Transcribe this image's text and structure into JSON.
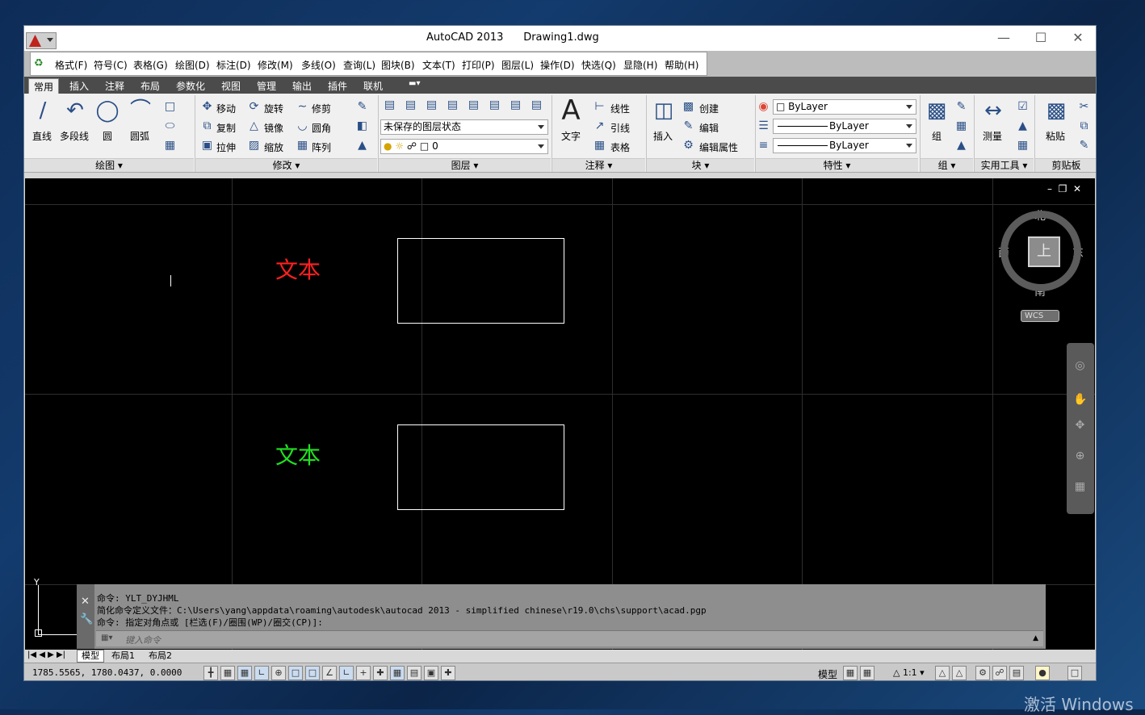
{
  "window": {
    "app_name": "AutoCAD 2013",
    "document": "Drawing1.dwg"
  },
  "menu": [
    "格式(F)",
    "符号(C)",
    "表格(G)",
    "绘图(D)",
    "标注(D)",
    "修改(M)",
    "多线(O)",
    "查询(L)",
    "图块(B)",
    "文本(T)",
    "打印(P)",
    "图层(L)",
    "操作(D)",
    "快选(Q)",
    "显隐(H)",
    "帮助(H)"
  ],
  "ribbon_tabs": [
    "常用",
    "插入",
    "注释",
    "布局",
    "参数化",
    "视图",
    "管理",
    "输出",
    "插件",
    "联机"
  ],
  "draw": {
    "line": "直线",
    "polyline": "多段线",
    "circle": "圆",
    "arc": "圆弧",
    "panel": "绘图"
  },
  "modify": {
    "move": "移动",
    "rotate": "旋转",
    "trim": "修剪",
    "copy": "复制",
    "mirror": "镜像",
    "fillet": "圆角",
    "stretch": "拉伸",
    "scale": "缩放",
    "array": "阵列",
    "panel": "修改"
  },
  "layer": {
    "state": "未保存的图层状态",
    "current": "0",
    "panel": "图层"
  },
  "annotation": {
    "text": "文字",
    "linear": "线性",
    "leader": "引线",
    "table": "表格",
    "panel": "注释"
  },
  "block": {
    "insert": "插入",
    "create": "创建",
    "edit": "编辑",
    "edit_attr": "编辑属性",
    "panel": "块"
  },
  "properties": {
    "color": "ByLayer",
    "lineweight": "ByLayer",
    "linetype": "ByLayer",
    "panel": "特性"
  },
  "groups": {
    "group": "组",
    "panel": "组"
  },
  "utilities": {
    "measure": "测量",
    "panel": "实用工具"
  },
  "clipboard": {
    "paste": "粘贴",
    "panel": "剪贴板"
  },
  "drawing": {
    "text1": {
      "value": "文本",
      "color": "#ff2020"
    },
    "text2": {
      "value": "文本",
      "color": "#21e021"
    }
  },
  "viewcube": {
    "top": "上",
    "north": "北",
    "south": "南",
    "east": "东",
    "west": "西",
    "wcs": "WCS"
  },
  "command": {
    "line1": "命令: YLT_DYJHML",
    "line2": "简化命令定义文件：C:\\Users\\yang\\appdata\\roaming\\autodesk\\autocad 2013 - simplified chinese\\r19.0\\chs\\support\\acad.pgp",
    "line3": "命令: 指定对角点或 [栏选(F)/圈围(WP)/圈交(CP)]:",
    "placeholder": "键入命令"
  },
  "layouts": [
    "模型",
    "布局1",
    "布局2"
  ],
  "status": {
    "coords": "1785.5565, 1780.0437, 0.0000",
    "model": "模型",
    "scale": "1:1"
  },
  "watermark": "激活 Windows"
}
